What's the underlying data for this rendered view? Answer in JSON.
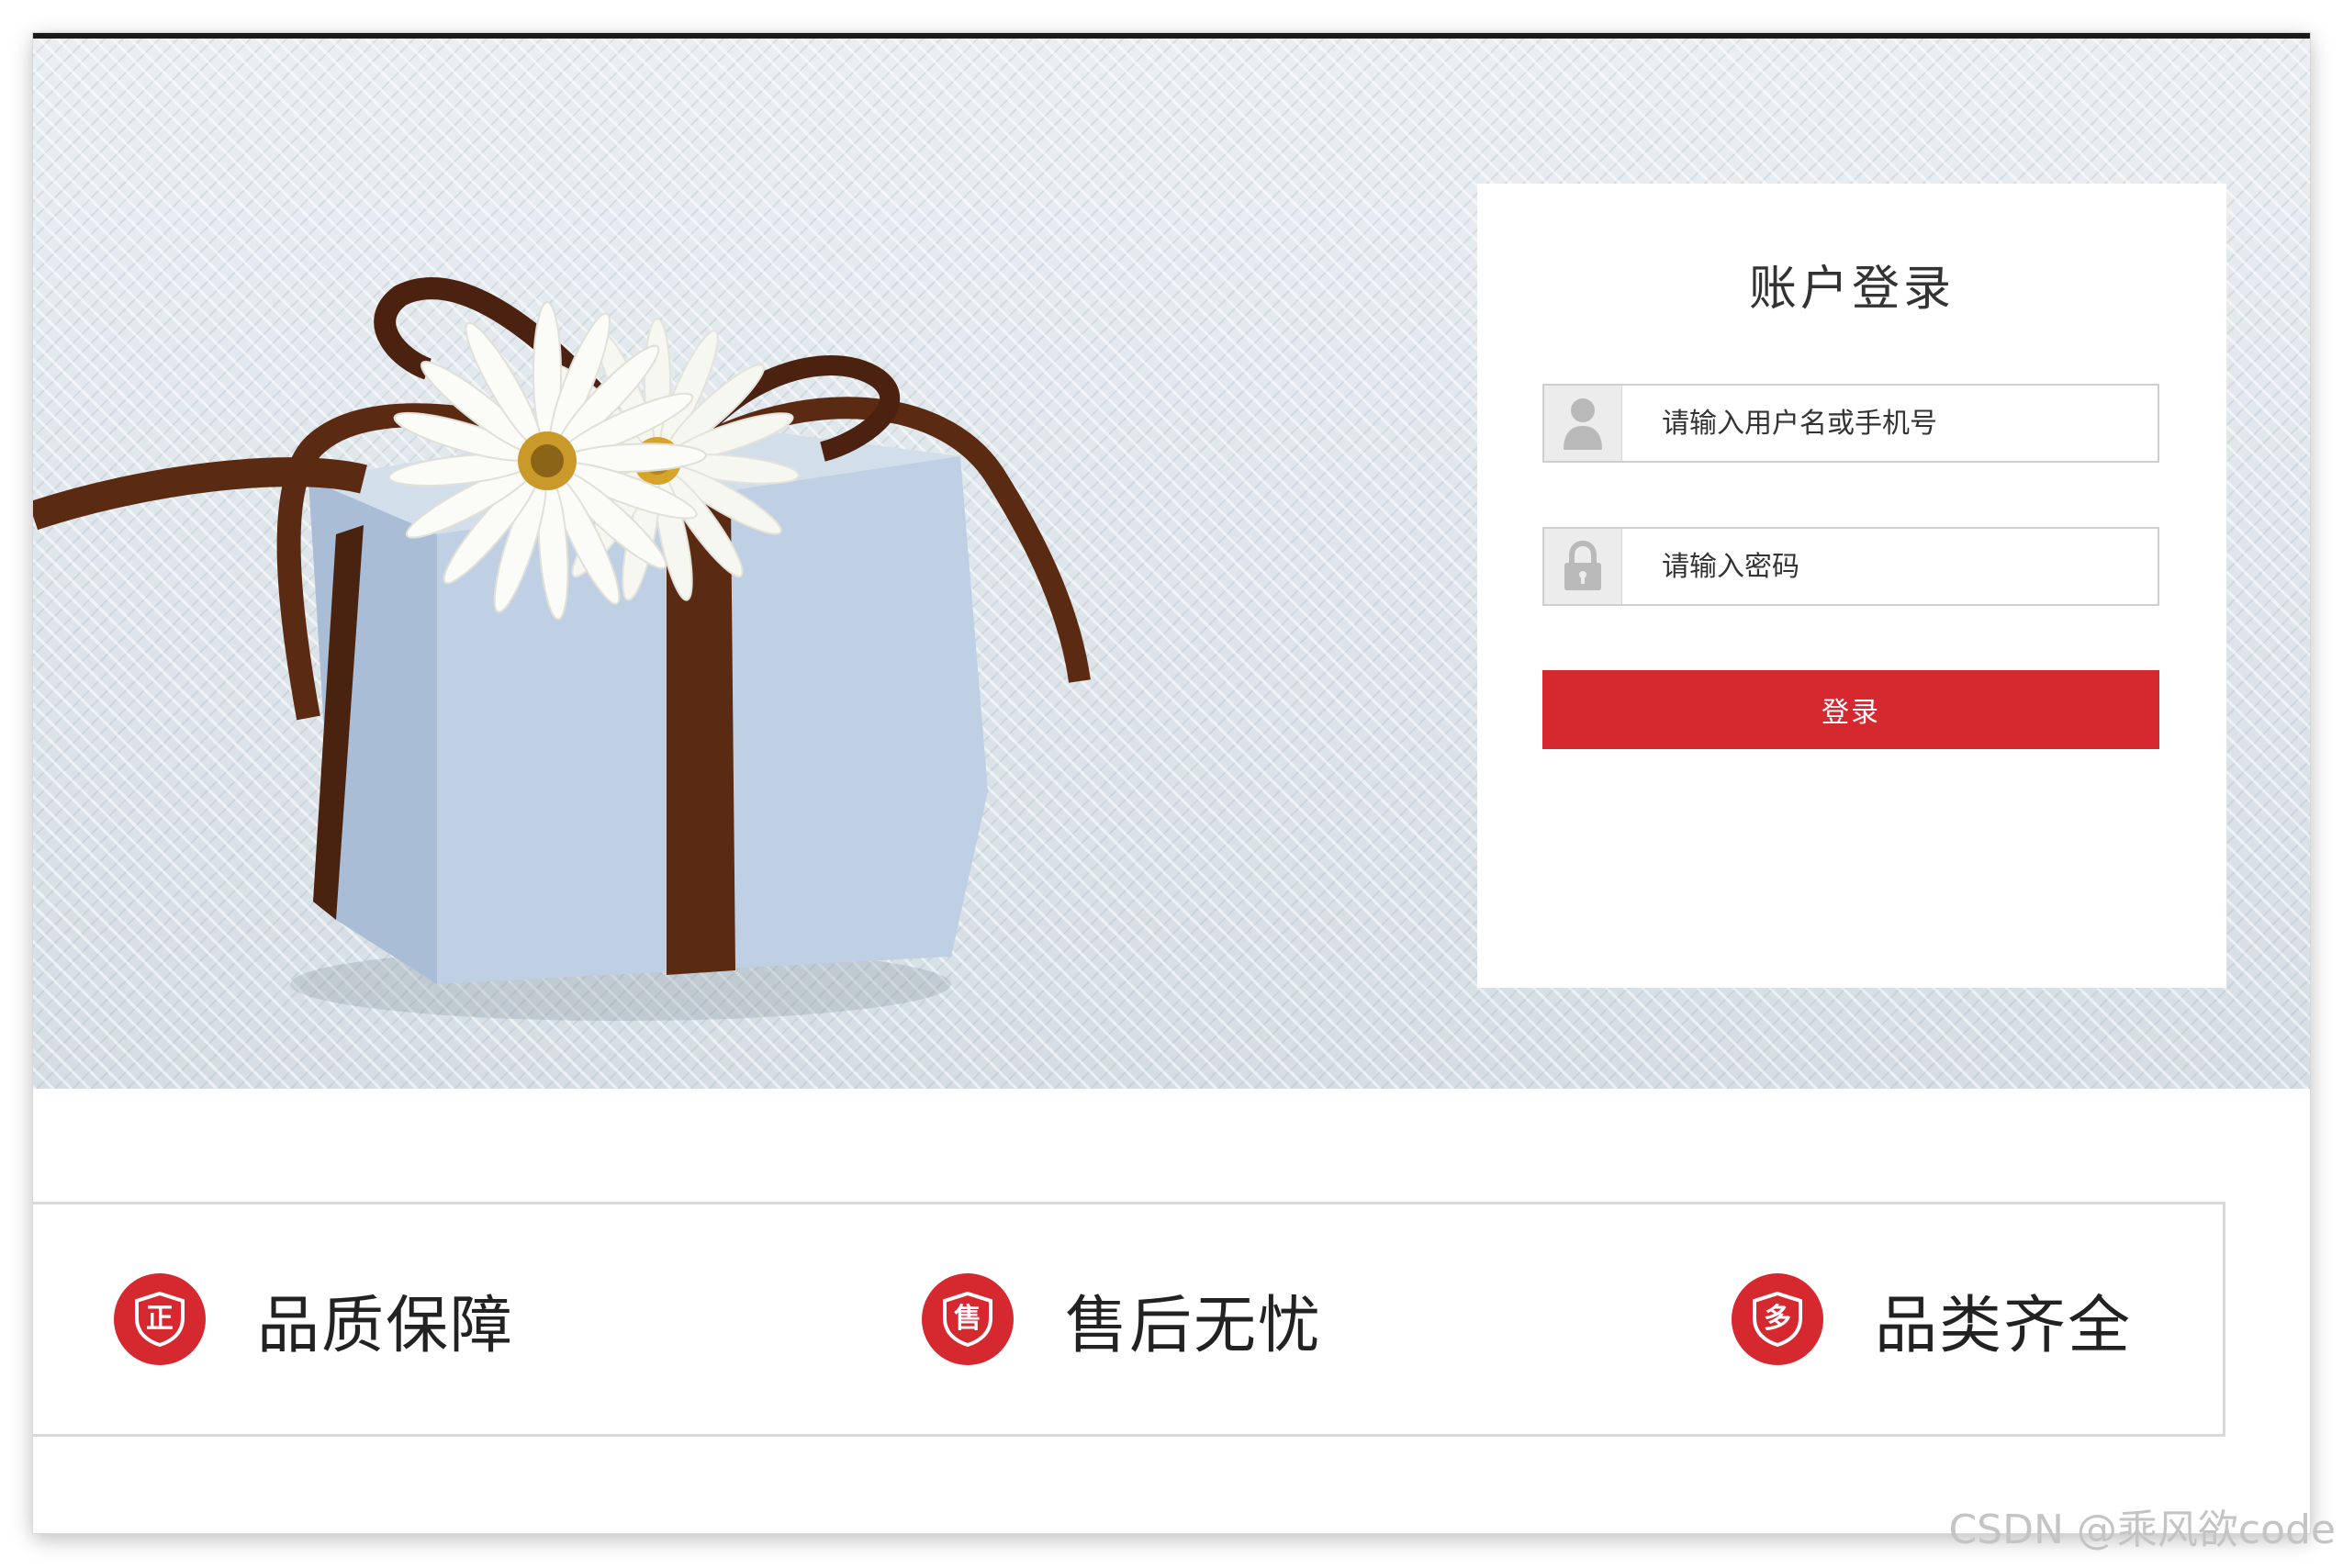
{
  "login": {
    "title": "账户登录",
    "username_placeholder": "请输入用户名或手机号",
    "password_placeholder": "请输入密码",
    "submit_label": "登录",
    "accent_color": "#d6282f"
  },
  "features": [
    {
      "icon": "shield-zheng-icon",
      "glyph": "正",
      "label": "品质保障"
    },
    {
      "icon": "shield-shou-icon",
      "glyph": "售",
      "label": "售后无忧"
    },
    {
      "icon": "shield-duo-icon",
      "glyph": "多",
      "label": "品类齐全"
    }
  ],
  "watermark": "CSDN @乘风欲code"
}
